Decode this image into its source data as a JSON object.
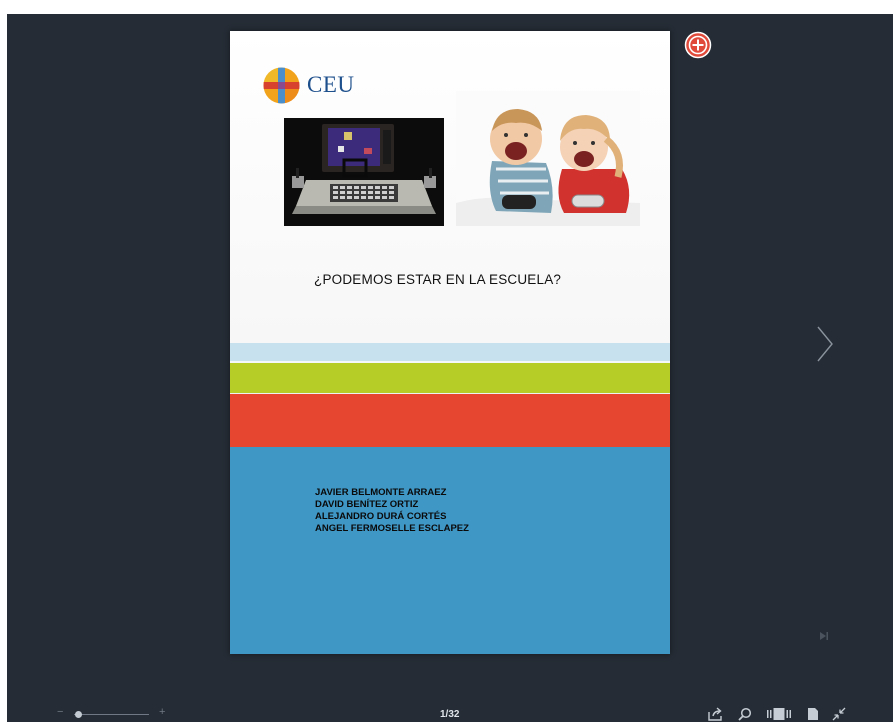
{
  "viewer": {
    "logo_text": "CEU",
    "cover_title": "¿PODEMOS ESTAR EN LA ESCUELA?",
    "authors": [
      "JAVIER BELMONTE ARRAEZ",
      "DAVID BENÍTEZ ORTIZ",
      "ALEJANDRO DURÁ CORTÉS",
      "ANGEL FERMOSELLE ESCLAPEZ"
    ],
    "page_counter": "1/32",
    "zoom_minus": "−",
    "zoom_plus": "+",
    "zoom_level": 0.05
  },
  "colors": {
    "background": "#252c35",
    "band_light": "#c7e1ef",
    "band_green": "#b5cd26",
    "band_red": "#e64630",
    "band_blue": "#3f97c6",
    "badge": "#e04a3a"
  },
  "icons": {
    "add_badge": "plus-circle-icon",
    "next": "chevron-right-icon",
    "end": "skip-to-end-icon",
    "share": "share-icon",
    "search": "search-icon",
    "thumbnails": "thumbnails-icon",
    "single_page": "single-page-icon",
    "fullscreen": "exit-fullscreen-icon"
  }
}
